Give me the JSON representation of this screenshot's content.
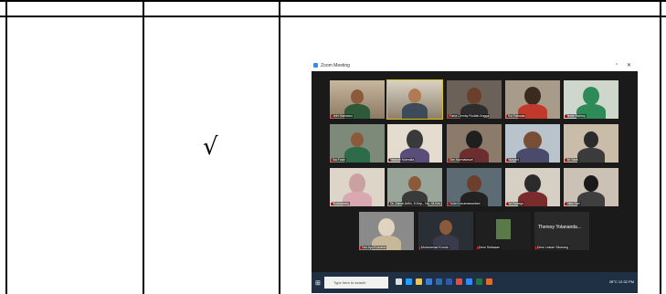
{
  "table": {
    "check_mark": "√"
  },
  "zoom": {
    "window_title": "Zoom Meeting",
    "participants": [
      {
        "name": "Jefri Hamdani"
      },
      {
        "name": ""
      },
      {
        "name": "Farra Cemby Rodiah Angga"
      },
      {
        "name": "Evi Fatmala"
      },
      {
        "name": "Yenie Rahmy"
      },
      {
        "name": "Ika Fuad"
      },
      {
        "name": "Hasnah Nurmala"
      },
      {
        "name": "Dini Nurmalasari"
      },
      {
        "name": "Nuryani"
      },
      {
        "name": "Sri Yanti"
      },
      {
        "name": "Rosidawaty"
      },
      {
        "name": "Dr. Zainal Arifin, S.Kep., Ns., M.Kes"
      },
      {
        "name": "Yulia Kusumawardani"
      },
      {
        "name": "Sri Rahayu"
      },
      {
        "name": "Okta Sari"
      },
      {
        "name": "Dwi Ayu Kusuma"
      },
      {
        "name": "Muhammad Kurnia"
      },
      {
        "name": "Dewi Setiawan"
      },
      {
        "name": "Dewi Lestari Sitohang",
        "text": "Theresy Yolananda..."
      }
    ],
    "taskbar": {
      "search_placeholder": "Type here to search",
      "tray": "28°C  12:32 PM"
    }
  }
}
